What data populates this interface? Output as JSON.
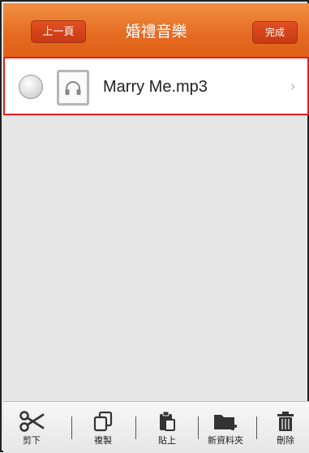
{
  "header": {
    "back_label": "上一頁",
    "title": "婚禮音樂",
    "done_label": "完成"
  },
  "files": [
    {
      "name": "Marry Me.mp3",
      "icon": "headphones-icon",
      "selected": false
    }
  ],
  "toolbar": {
    "cut": "剪下",
    "copy": "複製",
    "paste": "貼上",
    "new_folder": "新資料夾",
    "delete": "刪除"
  },
  "colors": {
    "header": "#e8691f",
    "accent_button": "#d1421a",
    "highlight_border": "#e01f1f"
  }
}
